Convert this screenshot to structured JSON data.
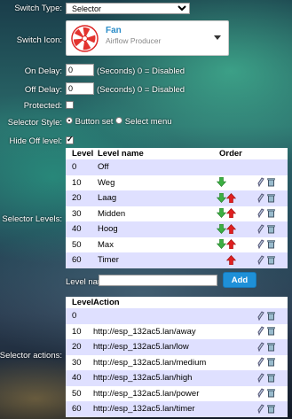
{
  "switch_type": {
    "label": "Switch Type:",
    "value": "Selector"
  },
  "switch_icon": {
    "label": "Switch Icon:",
    "name": "Fan",
    "description": "Airflow Producer"
  },
  "on_delay": {
    "label": "On Delay:",
    "value": "0",
    "note": "(Seconds) 0 = Disabled"
  },
  "off_delay": {
    "label": "Off Delay:",
    "value": "0",
    "note": "(Seconds) 0 = Disabled"
  },
  "protected": {
    "label": "Protected:",
    "checked": false
  },
  "selector_style": {
    "label": "Selector Style:",
    "options": [
      "Button set",
      "Select menu"
    ],
    "selected": "Button set"
  },
  "hide_off": {
    "label": "Hide Off level:",
    "checked": true
  },
  "levels": {
    "label": "Selector Levels:",
    "headers": {
      "level": "Level",
      "name": "Level name",
      "order": "Order"
    },
    "rows": [
      {
        "level": "0",
        "name": "Off",
        "down": false,
        "up": false,
        "tools": false
      },
      {
        "level": "10",
        "name": "Weg",
        "down": true,
        "up": false,
        "tools": true
      },
      {
        "level": "20",
        "name": "Laag",
        "down": true,
        "up": true,
        "tools": true
      },
      {
        "level": "30",
        "name": "Midden",
        "down": true,
        "up": true,
        "tools": true
      },
      {
        "level": "40",
        "name": "Hoog",
        "down": true,
        "up": true,
        "tools": true
      },
      {
        "level": "50",
        "name": "Max",
        "down": true,
        "up": true,
        "tools": true
      },
      {
        "level": "60",
        "name": "Timer",
        "down": false,
        "up": true,
        "tools": true
      }
    ]
  },
  "level_name": {
    "label": "Level name:",
    "value": "",
    "add_label": "Add"
  },
  "actions": {
    "label": "Selector actions:",
    "headers": {
      "level": "Level",
      "action": "Action"
    },
    "rows": [
      {
        "level": "0",
        "action": ""
      },
      {
        "level": "10",
        "action": "http://esp_132ac5.lan/away"
      },
      {
        "level": "20",
        "action": "http://esp_132ac5.lan/low"
      },
      {
        "level": "30",
        "action": "http://esp_132ac5.lan/medium"
      },
      {
        "level": "40",
        "action": "http://esp_132ac5.lan/high"
      },
      {
        "level": "50",
        "action": "http://esp_132ac5.lan/power"
      },
      {
        "level": "60",
        "action": "http://esp_132ac5.lan/timer"
      }
    ]
  },
  "colors": {
    "accent": "#1e90d8",
    "row_alt": "#dfe0ff",
    "arrow_down": "#3cb043",
    "arrow_up": "#e02020"
  }
}
